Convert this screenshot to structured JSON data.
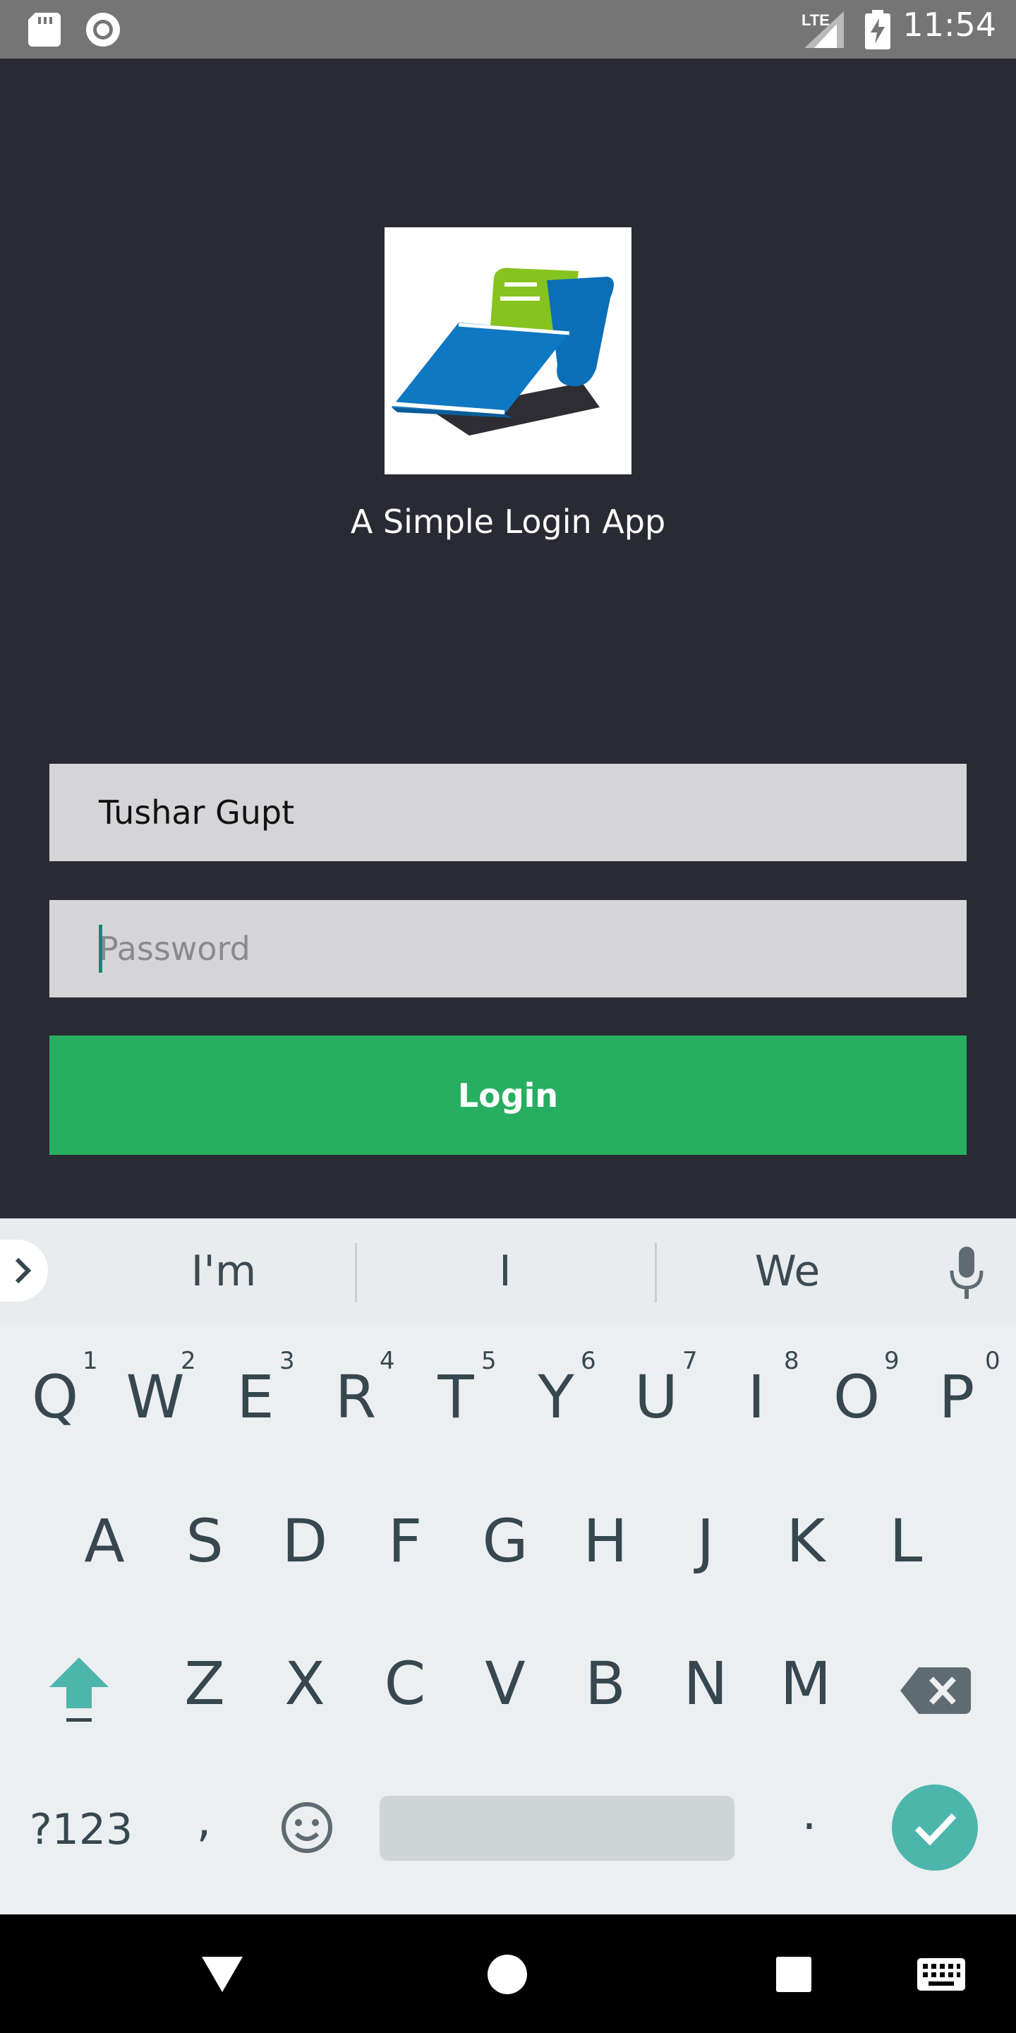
{
  "status_bar": {
    "time": "11:54",
    "network": "LTE",
    "icons": [
      "sd-card-icon",
      "sync-icon",
      "signal-icon",
      "battery-charging-icon"
    ]
  },
  "app": {
    "title": "A Simple Login App",
    "logo": "pos-terminal-logo",
    "username_value": "Tushar Gupt",
    "password_placeholder": "Password",
    "login_label": "Login"
  },
  "keyboard": {
    "suggestions": [
      "I'm",
      "I",
      "We"
    ],
    "row1": [
      "Q",
      "W",
      "E",
      "R",
      "T",
      "Y",
      "U",
      "I",
      "O",
      "P"
    ],
    "row1_hints": [
      "1",
      "2",
      "3",
      "4",
      "5",
      "6",
      "7",
      "8",
      "9",
      "0"
    ],
    "row2": [
      "A",
      "S",
      "D",
      "F",
      "G",
      "H",
      "J",
      "K",
      "L"
    ],
    "row3": [
      "Z",
      "X",
      "C",
      "V",
      "B",
      "N",
      "M"
    ],
    "symbols_label": "?123",
    "comma": ",",
    "period": "."
  },
  "colors": {
    "background": "#292a33",
    "field": "#d5d5d8",
    "login_button": "#28ae60",
    "accent": "#4db6ac"
  }
}
